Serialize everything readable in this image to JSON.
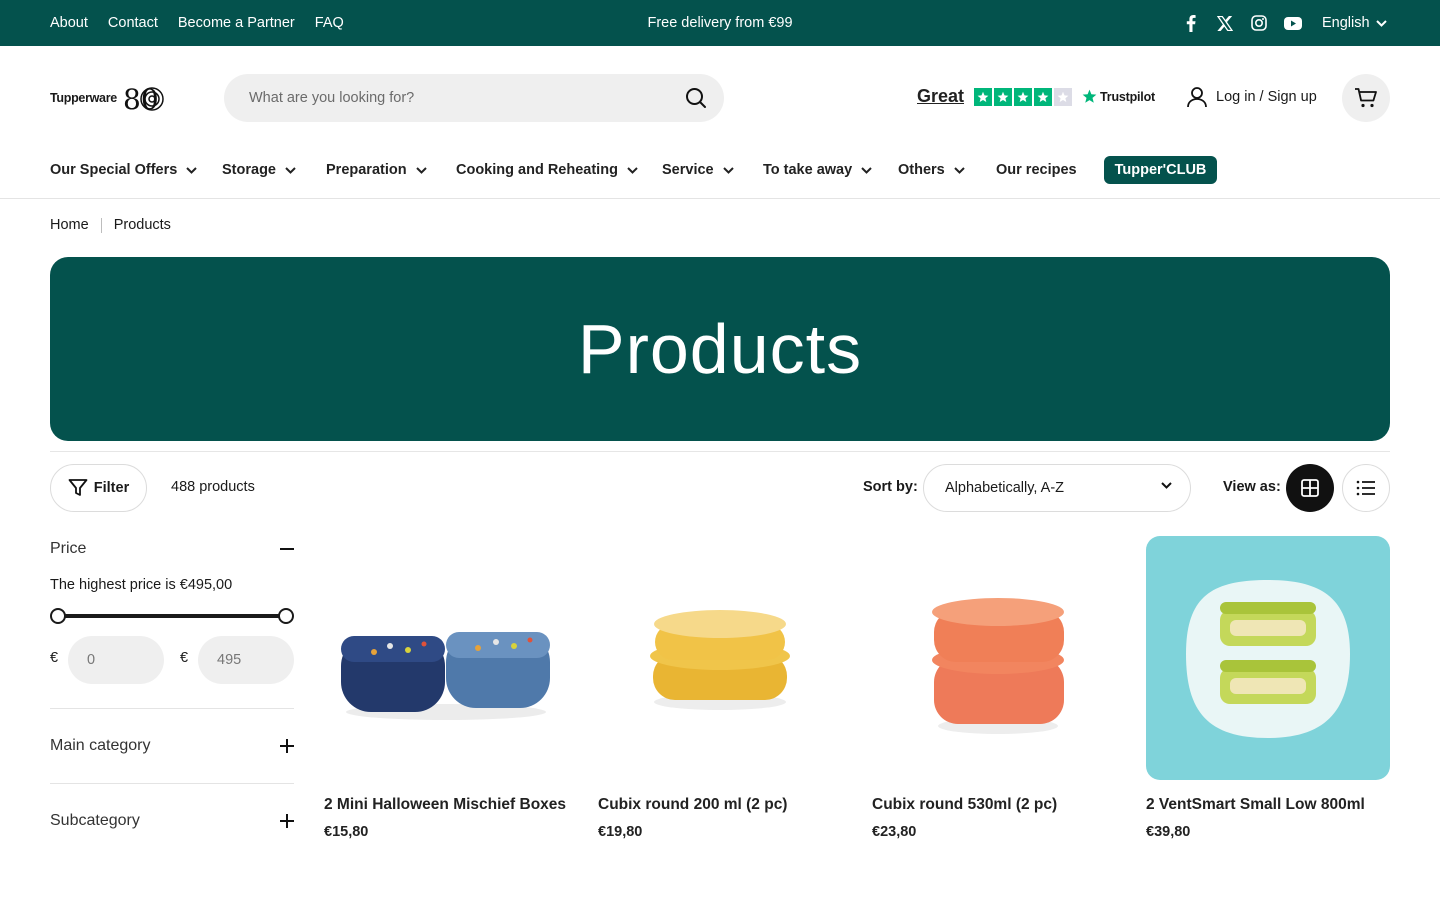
{
  "topbar": {
    "links": [
      "About",
      "Contact",
      "Become a Partner",
      "FAQ"
    ],
    "promo": "Free delivery from €99",
    "social_icons": [
      "facebook-icon",
      "x-icon",
      "instagram-icon",
      "youtube-icon"
    ],
    "language": "English"
  },
  "header": {
    "logo_text": "Tupperware",
    "logo_number": "80",
    "search_placeholder": "What are you looking for?",
    "trustpilot": {
      "rating_word": "Great",
      "stars_filled": 4,
      "stars_total": 5,
      "brand": "Trustpilot"
    },
    "login_label": "Log in / Sign up",
    "cart_icon": "cart-icon"
  },
  "nav": {
    "items": [
      {
        "label": "Our Special Offers",
        "dropdown": true
      },
      {
        "label": "Storage",
        "dropdown": true
      },
      {
        "label": "Preparation",
        "dropdown": true
      },
      {
        "label": "Cooking and Reheating",
        "dropdown": true
      },
      {
        "label": "Service",
        "dropdown": true
      },
      {
        "label": "To take away",
        "dropdown": true
      },
      {
        "label": "Others",
        "dropdown": true
      },
      {
        "label": "Our recipes",
        "dropdown": false
      }
    ],
    "club_label": "Tupper'CLUB"
  },
  "breadcrumb": [
    "Home",
    "Products"
  ],
  "hero": {
    "title": "Products"
  },
  "toolbar": {
    "filter_label": "Filter",
    "count_text": "488 products",
    "sort_label": "Sort by:",
    "sort_value": "Alphabetically, A-Z",
    "view_label": "View as:",
    "view_selected": "grid"
  },
  "filters": {
    "price": {
      "title": "Price",
      "note": "The highest price is €495,00",
      "currency": "€",
      "min_value": "0",
      "max_value": "495",
      "range_min_fraction": 0,
      "range_max_fraction": 1
    },
    "main_category": "Main category",
    "subcategory": "Subcategory"
  },
  "products": [
    {
      "name": "2 Mini Halloween Mischief Boxes",
      "price": "€15,80"
    },
    {
      "name": "Cubix round 200 ml (2 pc)",
      "price": "€19,80"
    },
    {
      "name": "Cubix round 530ml (2 pc)",
      "price": "€23,80"
    },
    {
      "name": "2 VentSmart Small Low 800ml",
      "price": "€39,80"
    }
  ],
  "colors": {
    "brand_green": "#04524d",
    "trustpilot_green": "#00b67a",
    "product4_bg": "#7fd3da"
  }
}
